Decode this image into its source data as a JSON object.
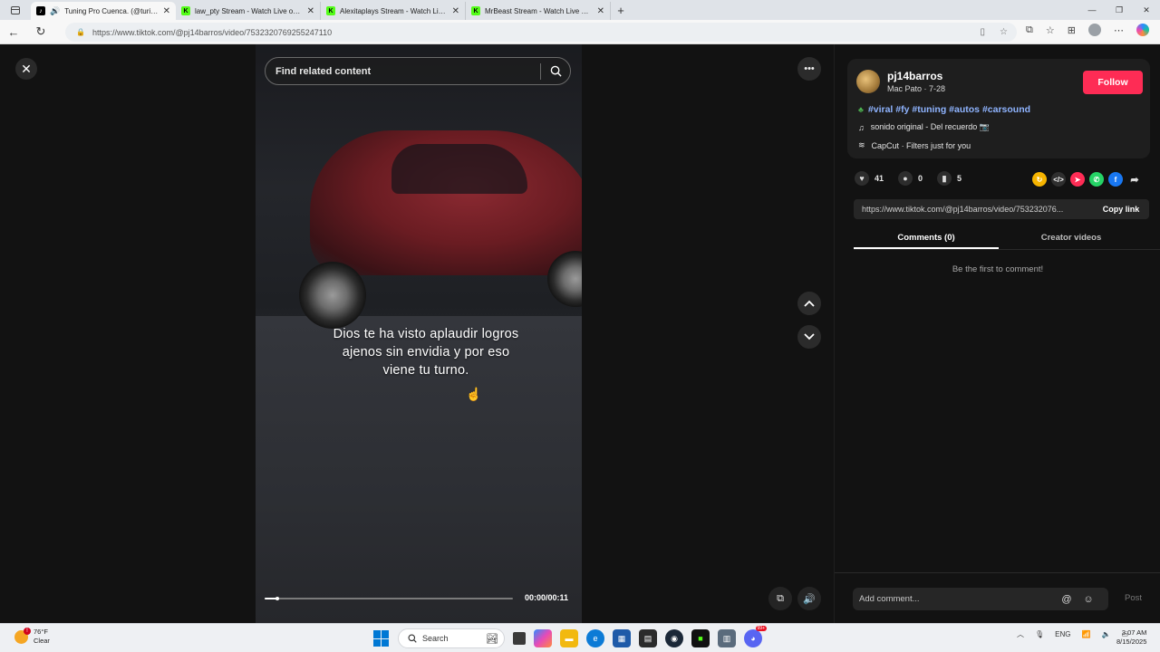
{
  "browser": {
    "tabs": [
      {
        "title": "Tuning Pro Cuenca. (@turin...",
        "favicon": "tiktok",
        "active": true,
        "audio": true
      },
      {
        "title": "law_pty Stream - Watch Live on K...",
        "favicon": "kick"
      },
      {
        "title": "Alexitaplays Stream - Watch Live...",
        "favicon": "kick"
      },
      {
        "title": "MrBeast Stream - Watch Live on K...",
        "favicon": "kick"
      }
    ],
    "url": "https://www.tiktok.com/@pj14barros/video/7532320769255247110"
  },
  "video": {
    "search_placeholder": "Find related content",
    "caption_lines": [
      "Dios te ha visto aplaudir logros",
      "ajenos sin envidia y por eso",
      "viene tu turno."
    ],
    "time": "00:00/00:11",
    "progress": 0.05
  },
  "author": {
    "username": "pj14barros",
    "subline": "Mac Pato · 7-28",
    "follow_label": "Follow"
  },
  "description": {
    "hashtags": "#viral #fy #tuning #autos #carsound",
    "music": "sonido original - Del recuerdo 📷",
    "effect": "CapCut · Filters just for you"
  },
  "stats": {
    "likes": "41",
    "comments": "0",
    "saves": "5"
  },
  "share_colors": [
    "#f6b400",
    "#2f2f2f",
    "#fe2c55",
    "#25d366",
    "#1877f2"
  ],
  "link": {
    "url": "https://www.tiktok.com/@pj14barros/video/753232076...",
    "copy_label": "Copy link"
  },
  "panel_tabs": {
    "comments": "Comments (0)",
    "creator": "Creator videos"
  },
  "empty_comments": "Be the first to comment!",
  "comment_box": {
    "placeholder": "Add comment...",
    "post_label": "Post"
  },
  "taskbar": {
    "weather_temp": "76°F",
    "weather_desc": "Clear",
    "search_label": "Search",
    "lang": "ENG",
    "time": "3:07 AM",
    "date": "8/15/2025",
    "notif_badge": "99+"
  }
}
